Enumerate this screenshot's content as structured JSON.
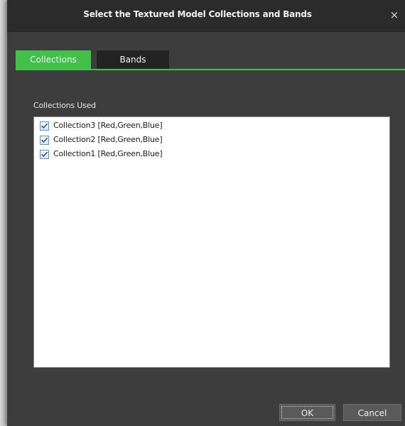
{
  "dialog": {
    "title": "Select the Textured Model Collections and Bands",
    "close_icon": "×"
  },
  "tabs": [
    {
      "label": "Collections",
      "active": true
    },
    {
      "label": "Bands",
      "active": false
    }
  ],
  "collections": {
    "section_label": "Collections Used",
    "items": [
      {
        "label": "Collection3 [Red,Green,Blue]",
        "checked": true
      },
      {
        "label": "Collection2 [Red,Green,Blue]",
        "checked": true
      },
      {
        "label": "Collection1 [Red,Green,Blue]",
        "checked": true
      }
    ]
  },
  "buttons": {
    "ok_label": "OK",
    "cancel_label": "Cancel"
  },
  "colors": {
    "accent_green": "#41c14a",
    "dialog_bg": "#3d3d3d",
    "titlebar_bg": "#2b2b2b",
    "inactive_tab_bg": "#232323"
  }
}
